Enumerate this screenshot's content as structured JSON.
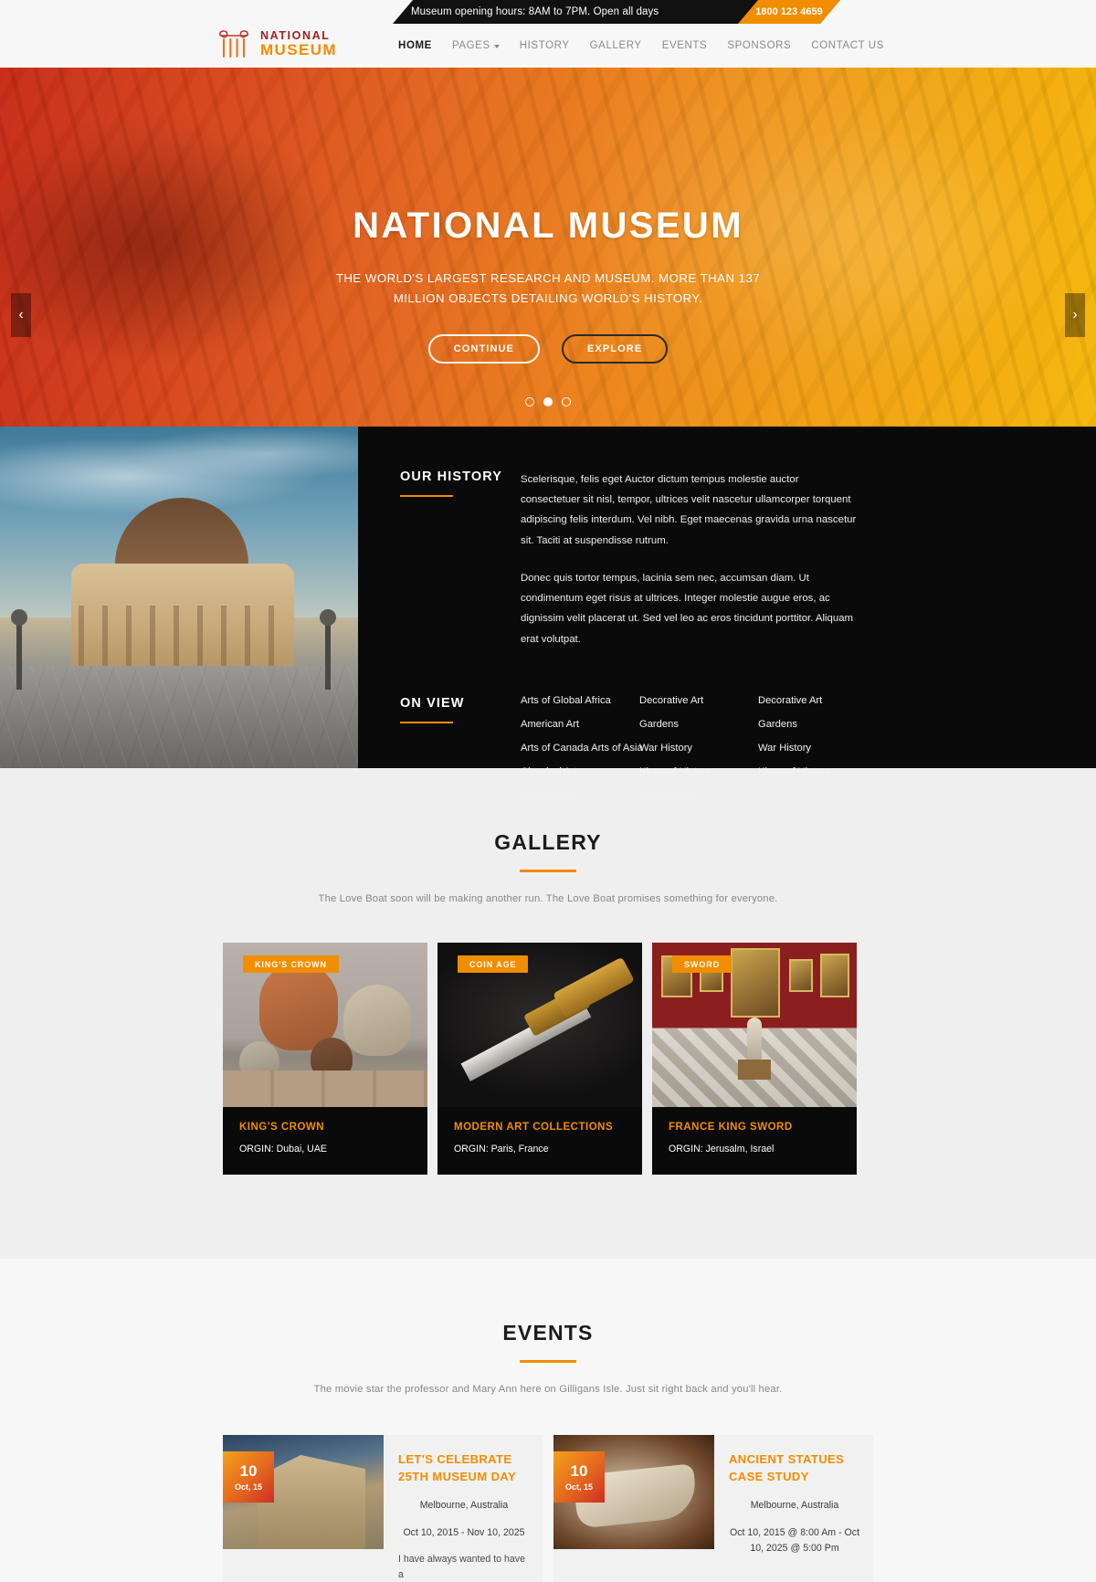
{
  "topbar": {
    "hours": "Museum opening hours: 8AM to 7PM. Open all days",
    "phone": "1800 123 4659"
  },
  "header": {
    "logo_line1": "NATIONAL",
    "logo_line2": "MUSEUM",
    "nav": [
      {
        "label": "HOME",
        "active": true,
        "caret": false
      },
      {
        "label": "PAGES",
        "active": false,
        "caret": true
      },
      {
        "label": "HISTORY",
        "active": false,
        "caret": false
      },
      {
        "label": "GALLERY",
        "active": false,
        "caret": false
      },
      {
        "label": "EVENTS",
        "active": false,
        "caret": false
      },
      {
        "label": "SPONSORS",
        "active": false,
        "caret": false
      },
      {
        "label": "CONTACT US",
        "active": false,
        "caret": false
      }
    ]
  },
  "hero": {
    "title": "NATIONAL MUSEUM",
    "subtitle": "THE WORLD'S LARGEST RESEARCH AND MUSEUM. MORE THAN 137 MILLION OBJECTS DETAILING WORLD'S HISTORY.",
    "btn_primary": "CONTINUE",
    "btn_secondary": "EXPLORE",
    "prev_arrow": "‹",
    "next_arrow": "›",
    "slide_count": 3,
    "active_slide": 2
  },
  "history": {
    "heading": "OUR HISTORY",
    "para1": "Scelerisque, felis eget Auctor dictum tempus molestie auctor consectetuer sit nisl, tempor, ultrices velit nascetur ullamcorper torquent adipiscing felis interdum. Vel nibh. Eget maecenas gravida urna nascetur sit. Taciti at suspendisse rutrum.",
    "para2": "Donec quis tortor tempus, lacinia sem nec, accumsan diam. Ut condimentum eget risus at ultrices. Integer molestie augue eros, ac dignissim velit placerat ut. Sed vel leo ac eros tincidunt porttitor. Aliquam erat volutpat.",
    "onview_heading": "ON VIEW",
    "onview_columns": [
      [
        "Arts of Global Africa",
        "American Art",
        "Arts of Canada Arts of Asia",
        "Classical Art",
        "German Arts"
      ],
      [
        "Decorative Art",
        "Gardens",
        "War History",
        "Kings of History",
        "German Arts"
      ],
      [
        "Decorative Art",
        "Gardens",
        "War History",
        "Kings of History"
      ]
    ]
  },
  "gallery": {
    "title": "GALLERY",
    "subtitle": "The Love Boat soon will be making another run. The Love Boat promises something for everyone.",
    "cards": [
      {
        "badge": "KING'S CROWN",
        "title": "KING'S CROWN",
        "meta": "ORGIN: Dubai, UAE"
      },
      {
        "badge": "COIN AGE",
        "title": "MODERN ART COLLECTIONS",
        "meta": "ORGIN: Paris, France"
      },
      {
        "badge": "SWORD",
        "title": "FRANCE KING SWORD",
        "meta": "ORGIN: Jerusalm, Israel"
      }
    ]
  },
  "events": {
    "title": "EVENTS",
    "subtitle": "The movie star the professor and Mary Ann here on Gilligans Isle. Just sit right back and you'll hear.",
    "items": [
      {
        "day": "10",
        "month": "Oct, 15",
        "title": "LET'S CELEBRATE 25TH MUSEUM DAY",
        "place": "Melbourne, Australia",
        "dates": "Oct 10, 2015 - Nov 10, 2025",
        "desc": "I have always wanted to have a"
      },
      {
        "day": "10",
        "month": "Oct, 15",
        "title": "ANCIENT STATUES CASE STUDY",
        "place": "Melbourne, Australia",
        "dates": "Oct 10, 2015 @ 8:00 Am - Oct 10, 2025 @ 5:00 Pm",
        "desc": ""
      }
    ]
  },
  "colors": {
    "accent_orange": "#f18d00",
    "logo_red": "#a02020",
    "dark": "#0a0a0a"
  }
}
